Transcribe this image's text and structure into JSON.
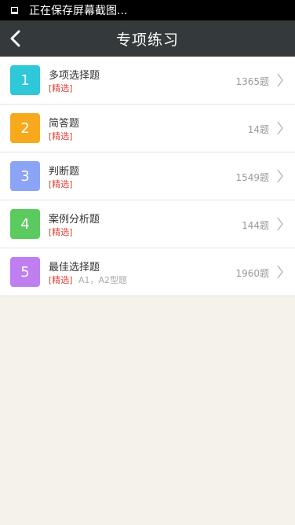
{
  "status": {
    "text": "正在保存屏幕截图..."
  },
  "header": {
    "title": "专项练习"
  },
  "items": [
    {
      "num": "1",
      "name": "多项选择题",
      "tag": "[精选]",
      "sub": "",
      "count": "1365题",
      "color": "#2ec8d8"
    },
    {
      "num": "2",
      "name": "简答题",
      "tag": "[精选]",
      "sub": "",
      "count": "14题",
      "color": "#f7a91b"
    },
    {
      "num": "3",
      "name": "判断题",
      "tag": "[精选]",
      "sub": "",
      "count": "1549题",
      "color": "#8ba4f5"
    },
    {
      "num": "4",
      "name": "案例分析题",
      "tag": "[精选]",
      "sub": "",
      "count": "144题",
      "color": "#5ccb5f"
    },
    {
      "num": "5",
      "name": "最佳选择题",
      "tag": "[精选]",
      "sub": "A1，A2型题",
      "count": "1960题",
      "color": "#bf7ff0"
    }
  ]
}
